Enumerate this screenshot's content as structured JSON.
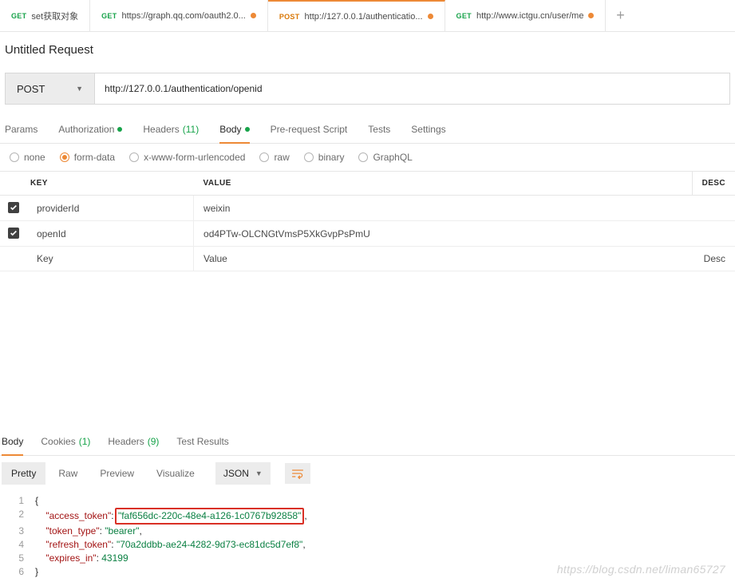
{
  "tabs": [
    {
      "method": "GET",
      "method_class": "method-get",
      "title": "set获取对象",
      "dirty": false
    },
    {
      "method": "GET",
      "method_class": "method-get",
      "title": "https://graph.qq.com/oauth2.0...",
      "dirty": true
    },
    {
      "method": "POST",
      "method_class": "method-post",
      "title": "http://127.0.0.1/authenticatio...",
      "dirty": true
    },
    {
      "method": "GET",
      "method_class": "method-get",
      "title": "http://www.ictgu.cn/user/me",
      "dirty": true
    }
  ],
  "active_tab_index": 2,
  "request_name": "Untitled Request",
  "method": "POST",
  "url": "http://127.0.0.1/authentication/openid",
  "req_tabs": {
    "params": "Params",
    "authorization": "Authorization",
    "headers": "Headers",
    "headers_count": "(11)",
    "body": "Body",
    "prerequest": "Pre-request Script",
    "tests": "Tests",
    "settings": "Settings"
  },
  "body_types": {
    "none": "none",
    "formdata": "form-data",
    "xwww": "x-www-form-urlencoded",
    "raw": "raw",
    "binary": "binary",
    "graphql": "GraphQL"
  },
  "kv_headers": {
    "key": "KEY",
    "value": "VALUE",
    "desc": "DESC"
  },
  "kv_rows": [
    {
      "key": "providerId",
      "value": "weixin"
    },
    {
      "key": "openId",
      "value": "od4PTw-OLCNGtVmsP5XkGvpPsPmU"
    }
  ],
  "kv_placeholder": {
    "key": "Key",
    "value": "Value",
    "desc": "Desc"
  },
  "resp_tabs": {
    "body": "Body",
    "cookies": "Cookies",
    "cookies_count": "(1)",
    "headers": "Headers",
    "headers_count": "(9)",
    "test_results": "Test Results"
  },
  "resp_toolbar": {
    "pretty": "Pretty",
    "raw": "Raw",
    "preview": "Preview",
    "visualize": "Visualize",
    "format": "JSON"
  },
  "response_json": {
    "access_token_key": "\"access_token\"",
    "access_token_val": "\"faf656dc-220c-48e4-a126-1c0767b92858\"",
    "token_type_key": "\"token_type\"",
    "token_type_val": "\"bearer\"",
    "refresh_token_key": "\"refresh_token\"",
    "refresh_token_val": "\"70a2ddbb-ae24-4282-9d73-ec81dc5d7ef8\"",
    "expires_in_key": "\"expires_in\"",
    "expires_in_val": "43199"
  },
  "line_numbers": [
    "1",
    "2",
    "3",
    "4",
    "5",
    "6"
  ],
  "watermark": "https://blog.csdn.net/liman65727"
}
